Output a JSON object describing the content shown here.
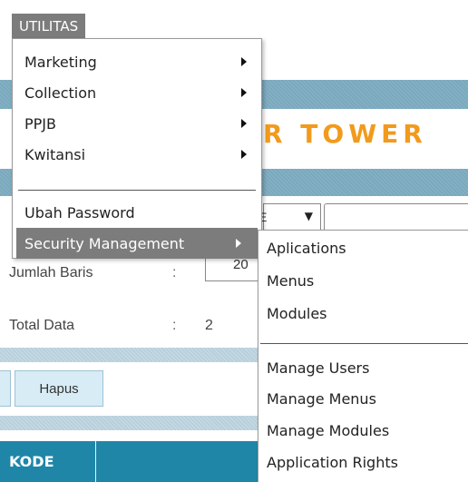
{
  "menubar": {
    "utilitas_label": "UTILITAS"
  },
  "utilitas_menu": {
    "items": [
      {
        "label": "Marketing",
        "has_submenu": true
      },
      {
        "label": "Collection",
        "has_submenu": true
      },
      {
        "label": "PPJB",
        "has_submenu": true
      },
      {
        "label": "Kwitansi",
        "has_submenu": true
      },
      {
        "label": "Ubah Password",
        "has_submenu": false
      },
      {
        "label": "Security Management",
        "has_submenu": true,
        "active": true
      }
    ]
  },
  "security_submenu": {
    "items": [
      {
        "label": "Aplications"
      },
      {
        "label": "Menus"
      },
      {
        "label": "Modules"
      },
      {
        "label": "Manage Users"
      },
      {
        "label": "Manage Menus"
      },
      {
        "label": "Manage Modules"
      },
      {
        "label": "Application Rights"
      }
    ]
  },
  "background": {
    "logo_text": "R TOWER",
    "jumlah_baris_label": "Jumlah Baris",
    "jumlah_baris_colon": ":",
    "jumlah_baris_value": "20",
    "total_data_label": "Total Data",
    "total_data_colon": ":",
    "total_data_value": "2",
    "select_partial": "E",
    "select_arrow": "▼",
    "hapus_button": "Hapus",
    "table_header_kode": "KODE"
  },
  "colors": {
    "menu_active_bg": "#7c7c7c",
    "band_blue": "#7aa9be",
    "logo_orange": "#f29a1c",
    "table_header_bg": "#1f86a8"
  }
}
